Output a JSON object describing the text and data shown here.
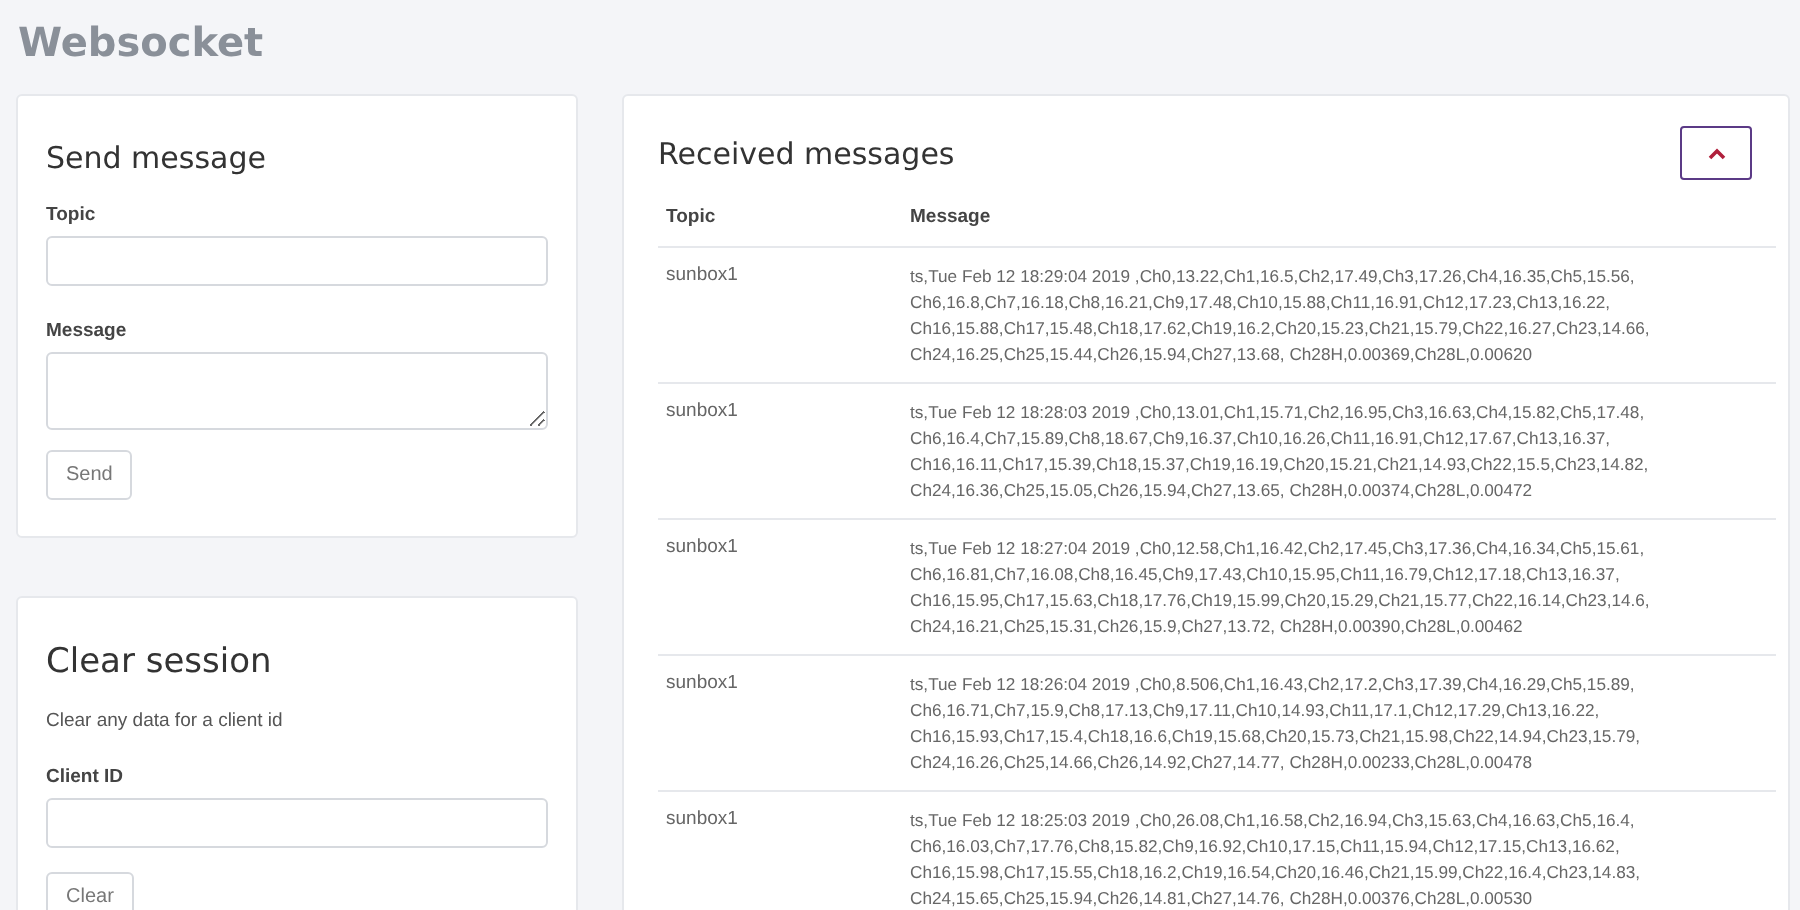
{
  "page_title": "Websocket",
  "send_message": {
    "title": "Send message",
    "fields": [
      {
        "label": "Topic",
        "kind": "input"
      },
      {
        "label": "Message",
        "kind": "textarea"
      }
    ],
    "button": "Send"
  },
  "clear_session": {
    "title": "Clear session",
    "description": "Clear any data for a client id",
    "fields": [
      {
        "label": "Client ID",
        "kind": "input"
      }
    ],
    "button": "Clear"
  },
  "received_messages": {
    "title": "Received messages",
    "columns": [
      "Topic",
      "Message"
    ],
    "rows": [
      {
        "topic": "sunbox1",
        "lines": [
          "ts,Tue Feb 12 18:29:04 2019 ,Ch0,13.22,Ch1,16.5,Ch2,17.49,Ch3,17.26,Ch4,16.35,Ch5,15.56,",
          "Ch6,16.8,Ch7,16.18,Ch8,16.21,Ch9,17.48,Ch10,15.88,Ch11,16.91,Ch12,17.23,Ch13,16.22,",
          "Ch16,15.88,Ch17,15.48,Ch18,17.62,Ch19,16.2,Ch20,15.23,Ch21,15.79,Ch22,16.27,Ch23,14.66,",
          "Ch24,16.25,Ch25,15.44,Ch26,15.94,Ch27,13.68, Ch28H,0.00369,Ch28L,0.00620"
        ]
      },
      {
        "topic": "sunbox1",
        "lines": [
          "ts,Tue Feb 12 18:28:03 2019 ,Ch0,13.01,Ch1,15.71,Ch2,16.95,Ch3,16.63,Ch4,15.82,Ch5,17.48,",
          "Ch6,16.4,Ch7,15.89,Ch8,18.67,Ch9,16.37,Ch10,16.26,Ch11,16.91,Ch12,17.67,Ch13,16.37,",
          "Ch16,16.11,Ch17,15.39,Ch18,15.37,Ch19,16.19,Ch20,15.21,Ch21,14.93,Ch22,15.5,Ch23,14.82,",
          "Ch24,16.36,Ch25,15.05,Ch26,15.94,Ch27,13.65, Ch28H,0.00374,Ch28L,0.00472"
        ]
      },
      {
        "topic": "sunbox1",
        "lines": [
          "ts,Tue Feb 12 18:27:04 2019 ,Ch0,12.58,Ch1,16.42,Ch2,17.45,Ch3,17.36,Ch4,16.34,Ch5,15.61,",
          "Ch6,16.81,Ch7,16.08,Ch8,16.45,Ch9,17.43,Ch10,15.95,Ch11,16.79,Ch12,17.18,Ch13,16.37,",
          "Ch16,15.95,Ch17,15.63,Ch18,17.76,Ch19,15.99,Ch20,15.29,Ch21,15.77,Ch22,16.14,Ch23,14.6,",
          "Ch24,16.21,Ch25,15.31,Ch26,15.9,Ch27,13.72, Ch28H,0.00390,Ch28L,0.00462"
        ]
      },
      {
        "topic": "sunbox1",
        "lines": [
          "ts,Tue Feb 12 18:26:04 2019 ,Ch0,8.506,Ch1,16.43,Ch2,17.2,Ch3,17.39,Ch4,16.29,Ch5,15.89,",
          "Ch6,16.71,Ch7,15.9,Ch8,17.13,Ch9,17.11,Ch10,14.93,Ch11,17.1,Ch12,17.29,Ch13,16.22,",
          "Ch16,15.93,Ch17,15.4,Ch18,16.6,Ch19,15.68,Ch20,15.73,Ch21,15.98,Ch22,14.94,Ch23,15.79,",
          "Ch24,16.26,Ch25,14.66,Ch26,14.92,Ch27,14.77, Ch28H,0.00233,Ch28L,0.00478"
        ]
      },
      {
        "topic": "sunbox1",
        "lines": [
          "ts,Tue Feb 12 18:25:03 2019 ,Ch0,26.08,Ch1,16.58,Ch2,16.94,Ch3,15.63,Ch4,16.63,Ch5,16.4,",
          "Ch6,16.03,Ch7,17.76,Ch8,15.82,Ch9,16.92,Ch10,17.15,Ch11,15.94,Ch12,17.15,Ch13,16.62,",
          "Ch16,15.98,Ch17,15.55,Ch18,16.2,Ch19,16.54,Ch20,16.46,Ch21,15.99,Ch22,16.4,Ch23,14.83,",
          "Ch24,15.65,Ch25,15.94,Ch26,14.81,Ch27,14.76, Ch28H,0.00376,Ch28L,0.00530"
        ]
      }
    ]
  }
}
